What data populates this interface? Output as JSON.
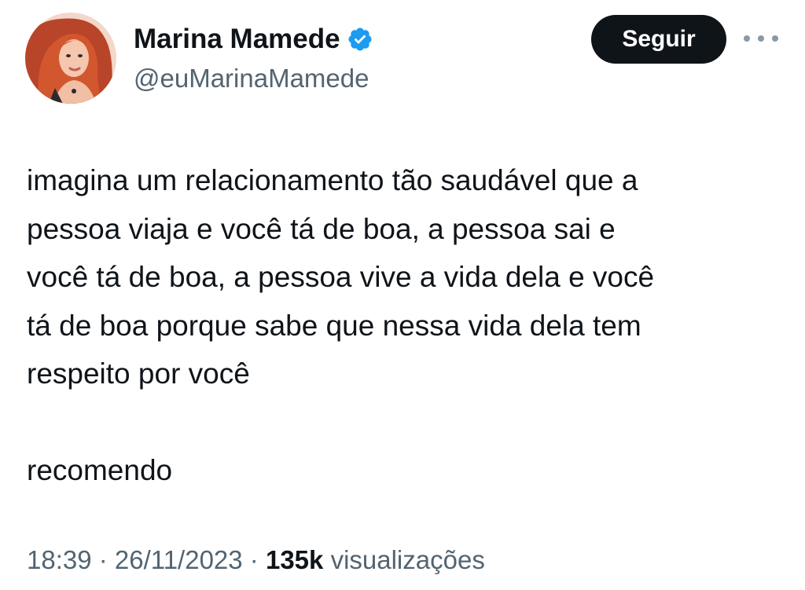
{
  "author": {
    "display_name": "Marina Mamede",
    "handle": "@euMarinaMamede",
    "avatar_icon": "profile-photo",
    "verified_icon": "verified-badge-icon",
    "verified_color": "#1d9bf0"
  },
  "actions": {
    "follow_label": "Seguir",
    "more_icon": "more-options-icon"
  },
  "tweet": {
    "text": "imagina um relacionamento tão saudável que a\npessoa viaja e você tá de boa, a pessoa sai e\nvocê tá de boa, a pessoa vive a vida dela e você\ntá de boa porque sabe que nessa vida dela tem\nrespeito por você\n\nrecomendo",
    "time": "18:39",
    "separator": " · ",
    "date": "26/11/2023",
    "views_count": "135k",
    "views_label": "visualizações"
  }
}
